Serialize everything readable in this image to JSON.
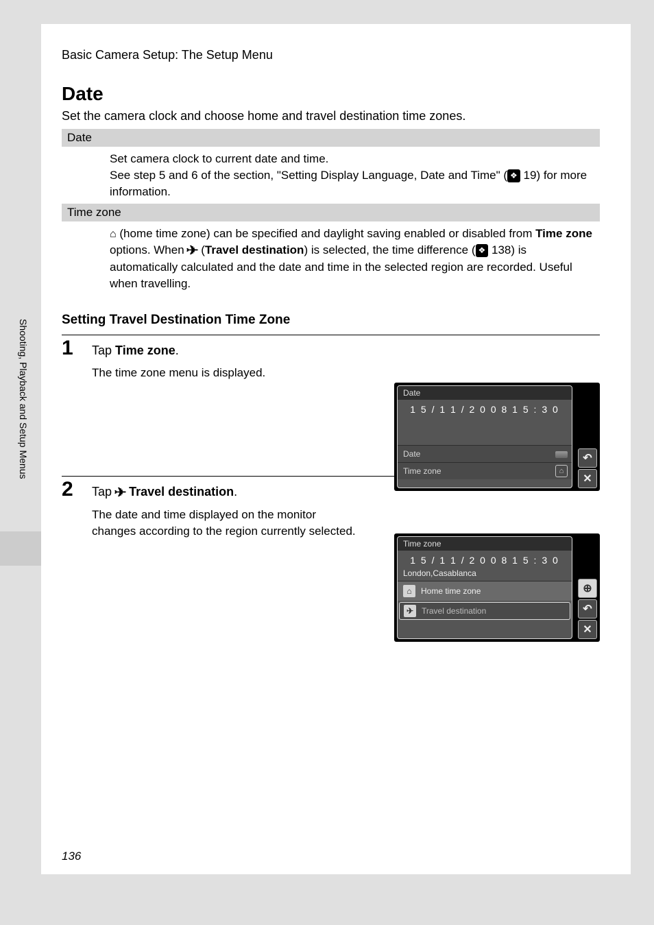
{
  "topHeading": "Basic Camera Setup: The Setup Menu",
  "title": "Date",
  "intro": "Set the camera clock and choose home and travel destination time zones.",
  "defs": {
    "date": {
      "head": "Date",
      "line1": "Set camera clock to current date and time.",
      "line2a": "See step 5 and 6 of the section, \"Setting Display Language, Date and Time\" (",
      "line2b": " 19) for more information."
    },
    "tz": {
      "head": "Time zone",
      "t1": " (home time zone) can be specified and daylight saving enabled or disabled from ",
      "t2": "Time zone",
      "t3": " options. When ",
      "t4": " (",
      "t5": "Travel destination",
      "t6": ") is selected, the time difference (",
      "t7": " 138) is automatically calculated and the date and time in the selected region are recorded. Useful when travelling."
    }
  },
  "subHeading": "Setting Travel Destination Time Zone",
  "steps": {
    "s1": {
      "num": "1",
      "title_a": "Tap ",
      "title_b": "Time zone",
      "title_c": ".",
      "body": "The time zone menu is displayed."
    },
    "s2": {
      "num": "2",
      "title_a": "Tap ",
      "title_b": " Travel destination",
      "title_c": ".",
      "body": "The date and time displayed on the monitor changes according to the region currently selected."
    }
  },
  "lcd1": {
    "title": "Date",
    "datetime": "1 5 / 1 1 / 2 0 0 8   1 5 : 3 0",
    "row1": "Date",
    "row2": "Time zone"
  },
  "lcd2": {
    "title": "Time zone",
    "datetime": "1 5 / 1 1 / 2 0 0 8   1 5 : 3 0",
    "location": "London,Casablanca",
    "row1": "Home time zone",
    "row2": "Travel destination"
  },
  "sideTab": "Shooting, Playback and Setup Menus",
  "pageNum": "136",
  "icons": {
    "pageref": "❖",
    "home": "⌂",
    "plane": "✈",
    "back": "↶",
    "close": "✕",
    "globe": "⊕",
    "bars": "▬"
  }
}
